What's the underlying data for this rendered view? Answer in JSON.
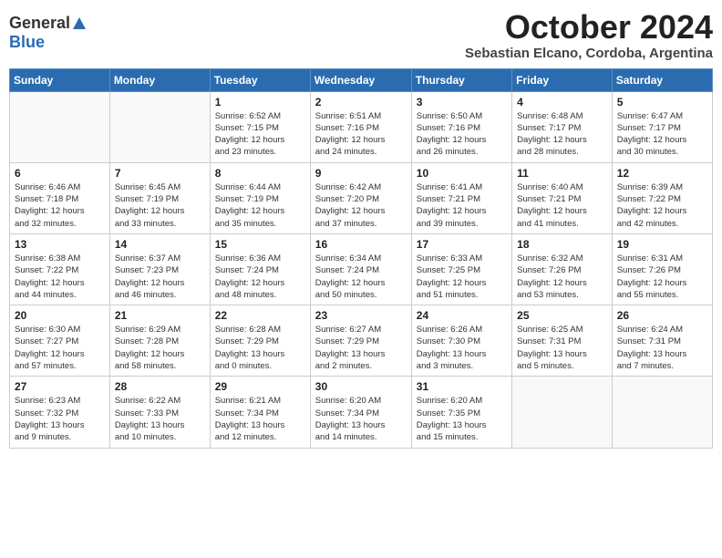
{
  "logo": {
    "general": "General",
    "blue": "Blue"
  },
  "title": "October 2024",
  "subtitle": "Sebastian Elcano, Cordoba, Argentina",
  "days_header": [
    "Sunday",
    "Monday",
    "Tuesday",
    "Wednesday",
    "Thursday",
    "Friday",
    "Saturday"
  ],
  "weeks": [
    [
      {
        "day": "",
        "info": ""
      },
      {
        "day": "",
        "info": ""
      },
      {
        "day": "1",
        "info": "Sunrise: 6:52 AM\nSunset: 7:15 PM\nDaylight: 12 hours\nand 23 minutes."
      },
      {
        "day": "2",
        "info": "Sunrise: 6:51 AM\nSunset: 7:16 PM\nDaylight: 12 hours\nand 24 minutes."
      },
      {
        "day": "3",
        "info": "Sunrise: 6:50 AM\nSunset: 7:16 PM\nDaylight: 12 hours\nand 26 minutes."
      },
      {
        "day": "4",
        "info": "Sunrise: 6:48 AM\nSunset: 7:17 PM\nDaylight: 12 hours\nand 28 minutes."
      },
      {
        "day": "5",
        "info": "Sunrise: 6:47 AM\nSunset: 7:17 PM\nDaylight: 12 hours\nand 30 minutes."
      }
    ],
    [
      {
        "day": "6",
        "info": "Sunrise: 6:46 AM\nSunset: 7:18 PM\nDaylight: 12 hours\nand 32 minutes."
      },
      {
        "day": "7",
        "info": "Sunrise: 6:45 AM\nSunset: 7:19 PM\nDaylight: 12 hours\nand 33 minutes."
      },
      {
        "day": "8",
        "info": "Sunrise: 6:44 AM\nSunset: 7:19 PM\nDaylight: 12 hours\nand 35 minutes."
      },
      {
        "day": "9",
        "info": "Sunrise: 6:42 AM\nSunset: 7:20 PM\nDaylight: 12 hours\nand 37 minutes."
      },
      {
        "day": "10",
        "info": "Sunrise: 6:41 AM\nSunset: 7:21 PM\nDaylight: 12 hours\nand 39 minutes."
      },
      {
        "day": "11",
        "info": "Sunrise: 6:40 AM\nSunset: 7:21 PM\nDaylight: 12 hours\nand 41 minutes."
      },
      {
        "day": "12",
        "info": "Sunrise: 6:39 AM\nSunset: 7:22 PM\nDaylight: 12 hours\nand 42 minutes."
      }
    ],
    [
      {
        "day": "13",
        "info": "Sunrise: 6:38 AM\nSunset: 7:22 PM\nDaylight: 12 hours\nand 44 minutes."
      },
      {
        "day": "14",
        "info": "Sunrise: 6:37 AM\nSunset: 7:23 PM\nDaylight: 12 hours\nand 46 minutes."
      },
      {
        "day": "15",
        "info": "Sunrise: 6:36 AM\nSunset: 7:24 PM\nDaylight: 12 hours\nand 48 minutes."
      },
      {
        "day": "16",
        "info": "Sunrise: 6:34 AM\nSunset: 7:24 PM\nDaylight: 12 hours\nand 50 minutes."
      },
      {
        "day": "17",
        "info": "Sunrise: 6:33 AM\nSunset: 7:25 PM\nDaylight: 12 hours\nand 51 minutes."
      },
      {
        "day": "18",
        "info": "Sunrise: 6:32 AM\nSunset: 7:26 PM\nDaylight: 12 hours\nand 53 minutes."
      },
      {
        "day": "19",
        "info": "Sunrise: 6:31 AM\nSunset: 7:26 PM\nDaylight: 12 hours\nand 55 minutes."
      }
    ],
    [
      {
        "day": "20",
        "info": "Sunrise: 6:30 AM\nSunset: 7:27 PM\nDaylight: 12 hours\nand 57 minutes."
      },
      {
        "day": "21",
        "info": "Sunrise: 6:29 AM\nSunset: 7:28 PM\nDaylight: 12 hours\nand 58 minutes."
      },
      {
        "day": "22",
        "info": "Sunrise: 6:28 AM\nSunset: 7:29 PM\nDaylight: 13 hours\nand 0 minutes."
      },
      {
        "day": "23",
        "info": "Sunrise: 6:27 AM\nSunset: 7:29 PM\nDaylight: 13 hours\nand 2 minutes."
      },
      {
        "day": "24",
        "info": "Sunrise: 6:26 AM\nSunset: 7:30 PM\nDaylight: 13 hours\nand 3 minutes."
      },
      {
        "day": "25",
        "info": "Sunrise: 6:25 AM\nSunset: 7:31 PM\nDaylight: 13 hours\nand 5 minutes."
      },
      {
        "day": "26",
        "info": "Sunrise: 6:24 AM\nSunset: 7:31 PM\nDaylight: 13 hours\nand 7 minutes."
      }
    ],
    [
      {
        "day": "27",
        "info": "Sunrise: 6:23 AM\nSunset: 7:32 PM\nDaylight: 13 hours\nand 9 minutes."
      },
      {
        "day": "28",
        "info": "Sunrise: 6:22 AM\nSunset: 7:33 PM\nDaylight: 13 hours\nand 10 minutes."
      },
      {
        "day": "29",
        "info": "Sunrise: 6:21 AM\nSunset: 7:34 PM\nDaylight: 13 hours\nand 12 minutes."
      },
      {
        "day": "30",
        "info": "Sunrise: 6:20 AM\nSunset: 7:34 PM\nDaylight: 13 hours\nand 14 minutes."
      },
      {
        "day": "31",
        "info": "Sunrise: 6:20 AM\nSunset: 7:35 PM\nDaylight: 13 hours\nand 15 minutes."
      },
      {
        "day": "",
        "info": ""
      },
      {
        "day": "",
        "info": ""
      }
    ]
  ]
}
